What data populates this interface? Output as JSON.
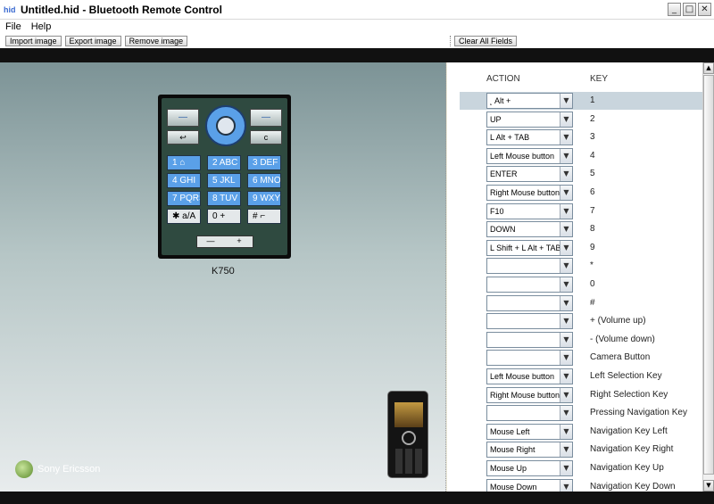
{
  "window": {
    "title": "Untitled.hid - Bluetooth Remote Control",
    "app_icon": "hid",
    "minimize": "_",
    "maximize": "□",
    "close": "✕"
  },
  "menu": {
    "file": "File",
    "help": "Help"
  },
  "toolbar": {
    "import_image": "Import image",
    "export_image": "Export image",
    "remove_image": "Remove image",
    "clear_all_fields": "Clear All Fields"
  },
  "phone": {
    "model": "K750",
    "brand": "Sony Ericsson",
    "soft_left": "—",
    "soft_right": "—",
    "back": "↩",
    "clear": "c",
    "keys": [
      {
        "label": "1 ⌂"
      },
      {
        "label": "2 ABC"
      },
      {
        "label": "3 DEF"
      },
      {
        "label": "4 GHI"
      },
      {
        "label": "5 JKL"
      },
      {
        "label": "6 MNO"
      },
      {
        "label": "7 PQRS"
      },
      {
        "label": "8 TUV"
      },
      {
        "label": "9 WXYZ"
      },
      {
        "label": "✱ a/A"
      },
      {
        "label": "0 +"
      },
      {
        "label": "# ⌐"
      }
    ],
    "vol_minus": "—",
    "vol_plus": "+"
  },
  "mapping": {
    "action_header": "ACTION",
    "key_header": "KEY",
    "rows": [
      {
        "action": "˛ Alt +",
        "key": "1"
      },
      {
        "action": "UP",
        "key": "2"
      },
      {
        "action": "L Alt + TAB",
        "key": "3"
      },
      {
        "action": "Left Mouse button",
        "key": "4"
      },
      {
        "action": "ENTER",
        "key": "5"
      },
      {
        "action": "Right Mouse button",
        "key": "6"
      },
      {
        "action": "F10",
        "key": "7"
      },
      {
        "action": "DOWN",
        "key": "8"
      },
      {
        "action": "L Shift + L Alt + TAB",
        "key": "9"
      },
      {
        "action": "",
        "key": "*"
      },
      {
        "action": "",
        "key": "0"
      },
      {
        "action": "",
        "key": "#"
      },
      {
        "action": "",
        "key": "+ (Volume up)"
      },
      {
        "action": "",
        "key": "- (Volume down)"
      },
      {
        "action": "",
        "key": "Camera Button"
      },
      {
        "action": "Left Mouse button",
        "key": "Left Selection Key"
      },
      {
        "action": "Right Mouse button",
        "key": "Right Selection Key"
      },
      {
        "action": "",
        "key": "Pressing Navigation Key"
      },
      {
        "action": "Mouse Left",
        "key": "Navigation Key Left"
      },
      {
        "action": "Mouse Right",
        "key": "Navigation Key Right"
      },
      {
        "action": "Mouse Up",
        "key": "Navigation Key Up"
      },
      {
        "action": "Mouse Down",
        "key": "Navigation Key Down"
      }
    ]
  }
}
